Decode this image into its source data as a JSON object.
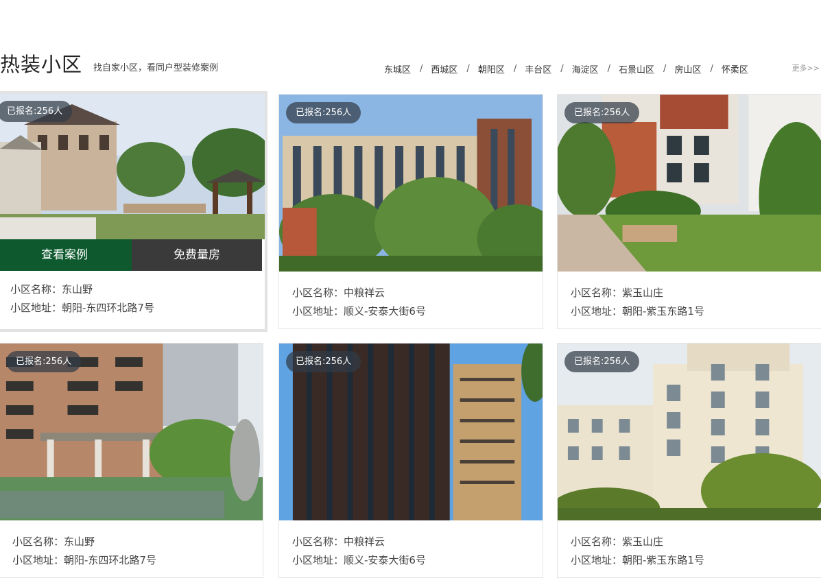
{
  "section": {
    "title": "热装小区",
    "subtitle": "找自家小区，看同户型装修案例",
    "more": "更多>>"
  },
  "districts": [
    "东城区",
    "西城区",
    "朝阳区",
    "丰台区",
    "海淀区",
    "石景山区",
    "房山区",
    "怀柔区"
  ],
  "separator": "/",
  "buttons": {
    "view": "查看案例",
    "measure": "免费量房"
  },
  "cards": [
    {
      "badge": "已报名:256人",
      "name": "小区名称：东山野",
      "address": "小区地址：朝阳-东四环北路7号"
    },
    {
      "badge": "已报名:256人",
      "name": "小区名称：中粮祥云",
      "address": "小区地址：顺义-安泰大街6号"
    },
    {
      "badge": "已报名:256人",
      "name": "小区名称：紫玉山庄",
      "address": "小区地址：朝阳-紫玉东路1号"
    },
    {
      "badge": "已报名:256人",
      "name": "小区名称：东山野",
      "address": "小区地址：朝阳-东四环北路7号"
    },
    {
      "badge": "已报名:256人",
      "name": "小区名称：中粮祥云",
      "address": "小区地址：顺义-安泰大街6号"
    },
    {
      "badge": "已报名:256人",
      "name": "小区名称：紫玉山庄",
      "address": "小区地址：朝阳-紫玉东路1号"
    }
  ]
}
